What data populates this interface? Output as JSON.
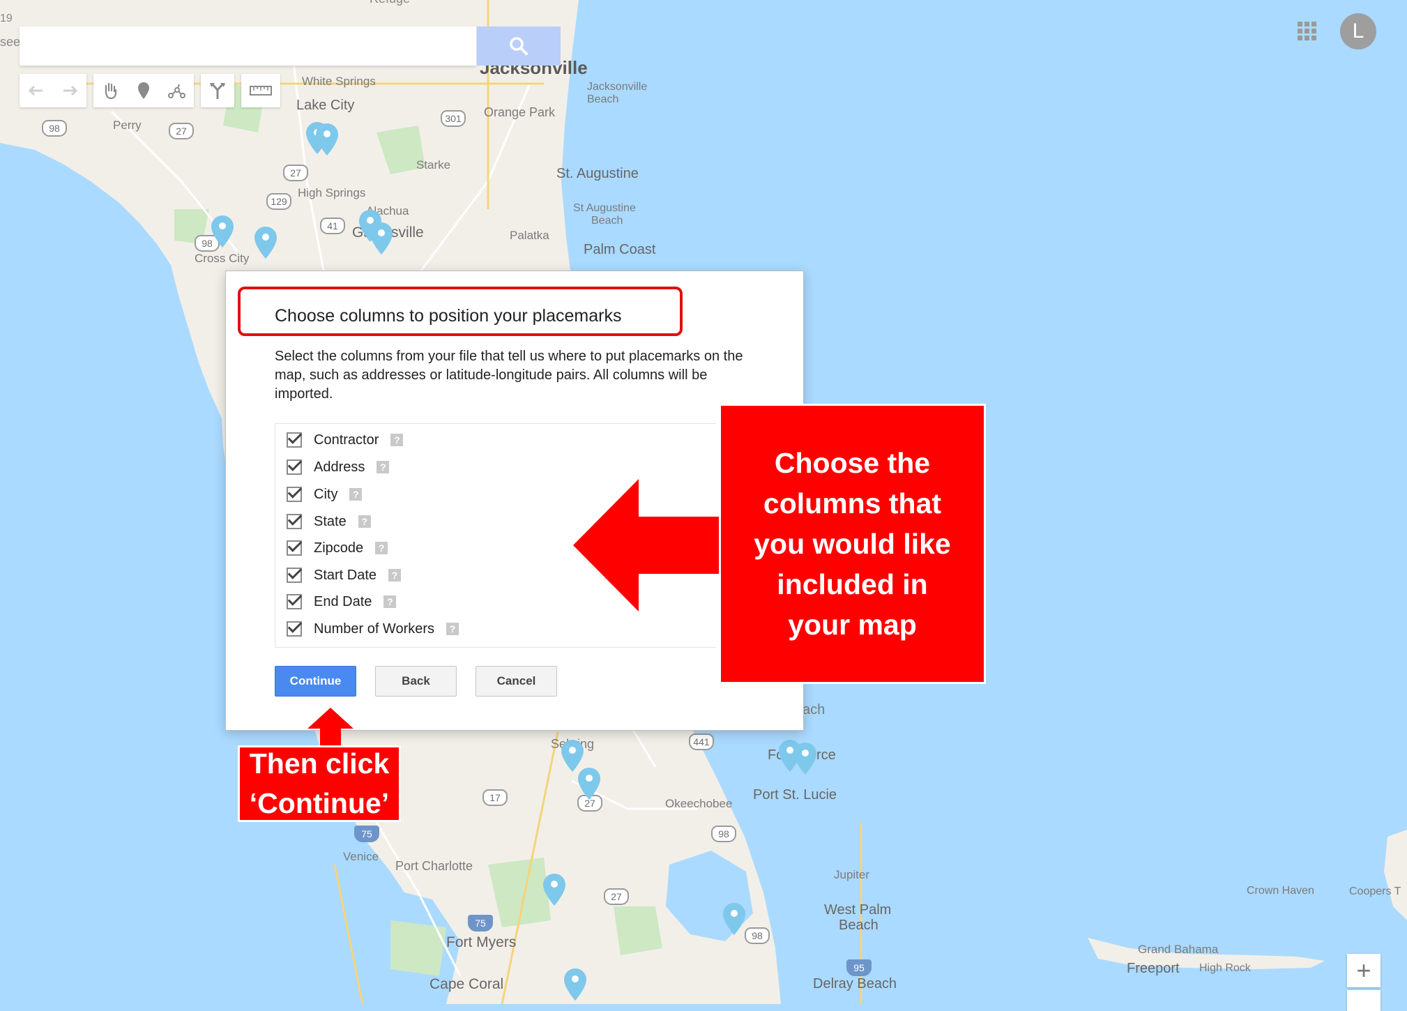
{
  "map": {
    "labels": {
      "jacksonville": "Jacksonville",
      "jacksonville_beach_1": "Jacksonville",
      "jacksonville_beach_2": "Beach",
      "white_springs": "White Springs",
      "lake_city": "Lake City",
      "orange_park": "Orange Park",
      "perry": "Perry",
      "starke": "Starke",
      "st_augustine": "St. Augustine",
      "high_springs": "High Springs",
      "alachua": "Alachua",
      "st_augustine_beach_1": "St Augustine",
      "st_augustine_beach_2": "Beach",
      "gainesville": "Gainesville",
      "palatka": "Palatka",
      "palm_coast": "Palm Coast",
      "cross_city": "Cross City",
      "sebring": "Sebring",
      "fort_pierce": "Fort Pierce",
      "port_st_lucie": "Port St. Lucie",
      "okeechobee": "Okeechobee",
      "venice": "Venice",
      "port_charlotte": "Port Charlotte",
      "jupiter": "Jupiter",
      "west_palm_beach_1": "West Palm",
      "west_palm_beach_2": "Beach",
      "crown_haven": "Crown Haven",
      "coopers_town": "Coopers T",
      "fort_myers": "Fort Myers",
      "grand_bahama": "Grand Bahama",
      "freeport": "Freeport",
      "high_rock": "High Rock",
      "cape_coral": "Cape Coral",
      "delray_beach": "Delray Beach",
      "ach_fragment": "ach",
      "edge_19": "19",
      "edge_see": "see",
      "refuge": "Refuge"
    },
    "shields": [
      "98",
      "27",
      "301",
      "27",
      "129",
      "41",
      "98",
      "441",
      "17",
      "27",
      "98",
      "75",
      "27",
      "75",
      "98",
      "95",
      "19"
    ]
  },
  "toolbar": {
    "undo": "undo-icon",
    "redo": "redo-icon",
    "hand": "hand-icon",
    "marker": "marker-icon",
    "line": "draw-line-icon",
    "directions": "directions-icon",
    "ruler": "ruler-icon"
  },
  "header": {
    "avatar_letter": "L"
  },
  "zoom": {
    "in_label": "+"
  },
  "dialog": {
    "title": "Choose columns to position your placemarks",
    "description": "Select the columns from your file that tell us where to put placemarks on the map, such as addresses or latitude-longitude pairs. All columns will be imported.",
    "columns": [
      {
        "label": "Contractor",
        "checked": true
      },
      {
        "label": "Address",
        "checked": true
      },
      {
        "label": "City",
        "checked": true
      },
      {
        "label": "State",
        "checked": true
      },
      {
        "label": "Zipcode",
        "checked": true
      },
      {
        "label": "Start Date",
        "checked": true
      },
      {
        "label": "End Date",
        "checked": true
      },
      {
        "label": "Number of Workers",
        "checked": true
      }
    ],
    "help_glyph": "?",
    "buttons": {
      "continue": "Continue",
      "back": "Back",
      "cancel": "Cancel"
    }
  },
  "annotations": {
    "callout_lines": [
      "Choose the",
      "columns that",
      "you would like",
      "included in",
      "your map"
    ],
    "then_lines": [
      "Then click",
      "‘Continue’"
    ],
    "accent_color": "#ff0000"
  },
  "colors": {
    "water": "#aadaff",
    "land": "#f2efe9",
    "park": "#cde8c2",
    "pin": "#7ec8ec",
    "primary_button": "#4a8af0"
  }
}
